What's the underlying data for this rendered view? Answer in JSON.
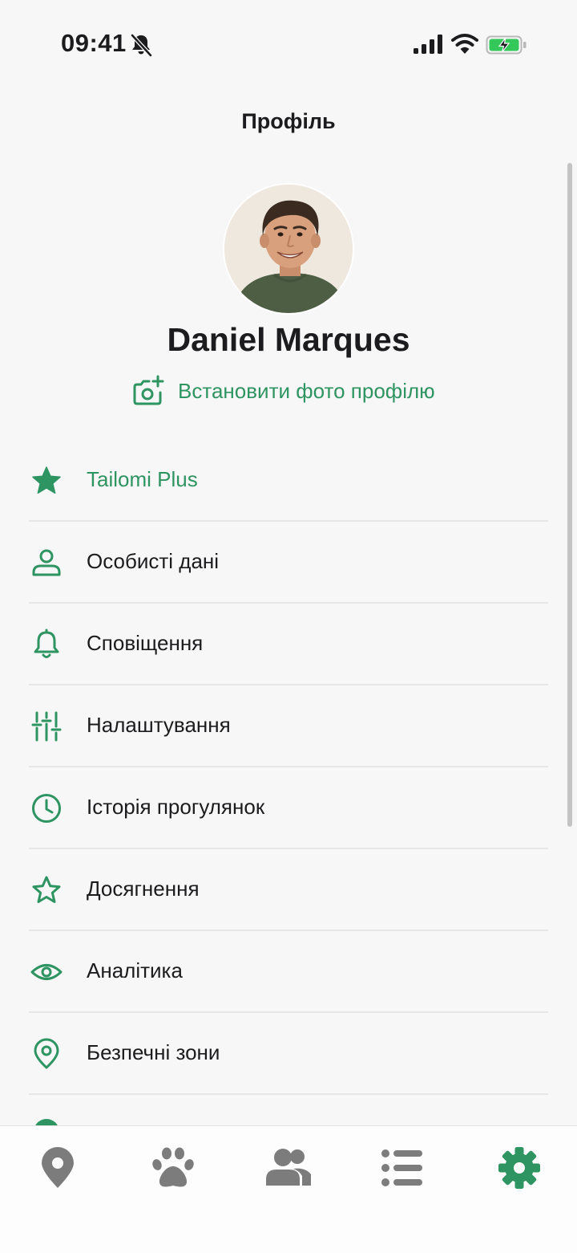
{
  "status_bar": {
    "time": "09:41",
    "icons": [
      "bell-off-icon",
      "cellular-signal-icon",
      "wifi-icon",
      "battery-charging-icon"
    ]
  },
  "header": {
    "title": "Профіль"
  },
  "profile": {
    "name": "Daniel Marques",
    "set_photo_label": "Встановити фото профілю"
  },
  "menu": [
    {
      "label": "Tailomi Plus",
      "icon": "star-filled-icon"
    },
    {
      "label": "Особисті дані",
      "icon": "person-icon"
    },
    {
      "label": "Сповіщення",
      "icon": "bell-icon"
    },
    {
      "label": "Налаштування",
      "icon": "sliders-icon"
    },
    {
      "label": "Історія прогулянок",
      "icon": "clock-icon"
    },
    {
      "label": "Досягнення",
      "icon": "star-outline-icon"
    },
    {
      "label": "Аналітика",
      "icon": "eye-icon"
    },
    {
      "label": "Безпечні зони",
      "icon": "map-pin-icon"
    }
  ],
  "tab_bar": {
    "tabs": [
      "map-pin-icon",
      "paw-icon",
      "people-icon",
      "list-icon",
      "gear-icon"
    ],
    "active": "gear-icon"
  },
  "colors": {
    "accent": "#2e9461",
    "background": "#f7f7f7",
    "text": "#1c1c1e",
    "inactive_tab": "#7c7c7c",
    "divider": "#e6e6e6"
  }
}
